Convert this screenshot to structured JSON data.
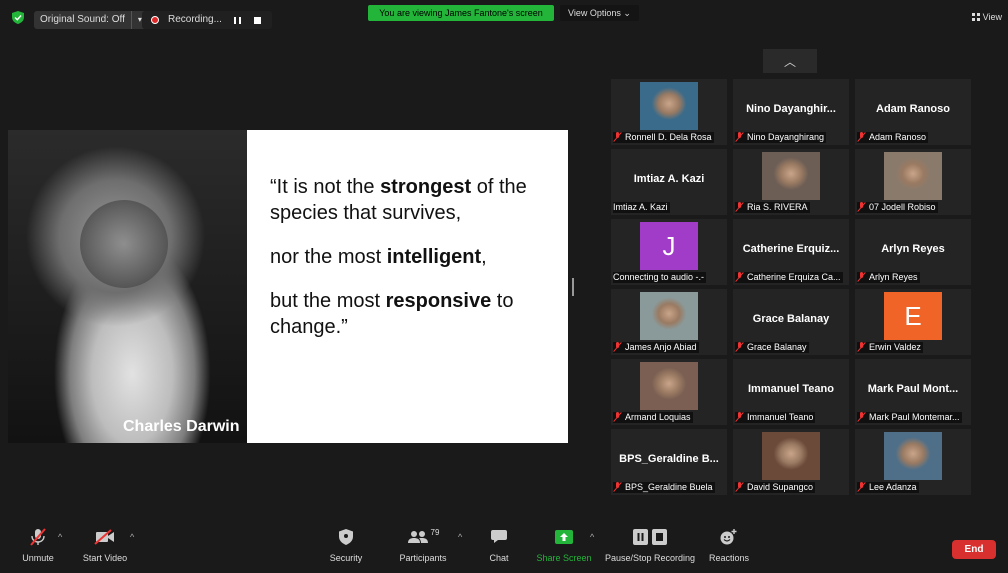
{
  "topbar": {
    "original_sound": "Original Sound: Off",
    "recording": "Recording...",
    "viewing_banner": "You are viewing James Fantone's screen",
    "view_options": "View Options ⌄",
    "view": "View"
  },
  "slide": {
    "caption": "Charles Darwin",
    "q1_a": "“It is not the ",
    "q1_b": "strongest",
    "q1_c": " of the species that survives,",
    "q2_a": "nor the most ",
    "q2_b": "intelligent",
    "q2_c": ",",
    "q3_a": "but the most ",
    "q3_b": "responsive",
    "q3_c": " to change.”"
  },
  "gallery": [
    {
      "name": "Ronnell D. Dela Rosa",
      "big": "",
      "initial": "",
      "color": "#3b6b8a",
      "muted": true
    },
    {
      "name": "Nino Dayanghirang",
      "big": "Nino  Dayanghir...",
      "initial": "",
      "color": "",
      "muted": true
    },
    {
      "name": "Adam Ranoso",
      "big": "Adam Ranoso",
      "initial": "",
      "color": "",
      "muted": true
    },
    {
      "name": "Imtiaz A. Kazi",
      "big": "Imtiaz A. Kazi",
      "initial": "",
      "color": "",
      "muted": false
    },
    {
      "name": "Ria S. RIVERA",
      "big": "",
      "initial": "",
      "color": "#6d5e55",
      "muted": true
    },
    {
      "name": "07 Jodell Robiso",
      "big": "",
      "initial": "",
      "color": "#8a7a6b",
      "muted": true
    },
    {
      "name": "Connecting to audio -.-",
      "big": "",
      "initial": "J",
      "color": "#a13cc8",
      "muted": false
    },
    {
      "name": "Catherine Erquiza Ca...",
      "big": "Catherine  Erquiz...",
      "initial": "",
      "color": "",
      "muted": true
    },
    {
      "name": "Arlyn Reyes",
      "big": "Arlyn Reyes",
      "initial": "",
      "color": "",
      "muted": true
    },
    {
      "name": "James Anjo Abiad",
      "big": "",
      "initial": "",
      "color": "#8a9a9a",
      "muted": true
    },
    {
      "name": "Grace Balanay",
      "big": "Grace Balanay",
      "initial": "",
      "color": "",
      "muted": true
    },
    {
      "name": "Erwin Valdez",
      "big": "",
      "initial": "E",
      "color": "#f06428",
      "muted": true
    },
    {
      "name": "Armand Loquias",
      "big": "",
      "initial": "",
      "color": "#7a5f52",
      "muted": true
    },
    {
      "name": "Immanuel Teano",
      "big": "Immanuel Teano",
      "initial": "",
      "color": "",
      "muted": true
    },
    {
      "name": "Mark Paul Montemar...",
      "big": "Mark Paul  Mont...",
      "initial": "",
      "color": "",
      "muted": true
    },
    {
      "name": "BPS_Geraldine Buela",
      "big": "BPS_Geraldine  B...",
      "initial": "",
      "color": "",
      "muted": true
    },
    {
      "name": "David Supangco",
      "big": "",
      "initial": "",
      "color": "#6b4a3a",
      "muted": true
    },
    {
      "name": "Lee Adanza",
      "big": "",
      "initial": "",
      "color": "#4f6f88",
      "muted": true
    }
  ],
  "toolbar": {
    "unmute": "Unmute",
    "start_video": "Start Video",
    "security": "Security",
    "participants": "Participants",
    "participant_count": "79",
    "chat": "Chat",
    "share_screen": "Share Screen",
    "pause_recording": "Pause/Stop Recording",
    "reactions": "Reactions",
    "end": "End"
  },
  "colors": {
    "banner_green": "#23b53a",
    "end_red": "#d82f2f",
    "share_green": "#23b53a"
  }
}
